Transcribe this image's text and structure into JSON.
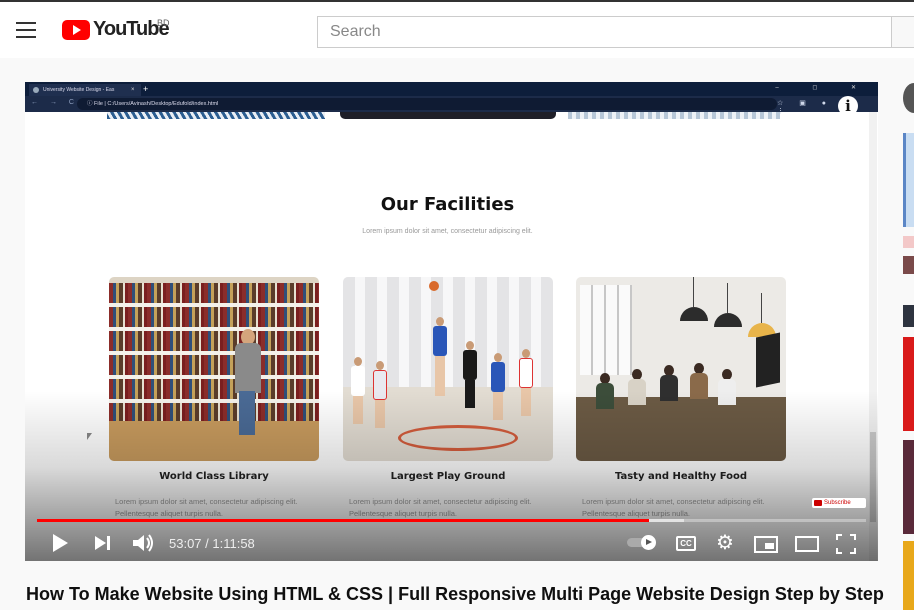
{
  "youtube": {
    "logo_text": "YouTube",
    "country_code": "BD",
    "search_placeholder": "Search"
  },
  "browser": {
    "tab_title": "University Website Design - Eas",
    "tab_close": "×",
    "new_tab": "+",
    "window_controls": "‒ ◻ ✕",
    "nav_arrows": "← → C",
    "address": "ⓘ  File  |  C:/Users/Avinash/Desktop/Edufold/index.html",
    "toolbar_icons": "☆ ▣ ● ▲ ⋮",
    "info_icon": "i"
  },
  "website": {
    "section_title": "Our Facilities",
    "section_subtitle": "Lorem ipsum dolor sit amet, consectetur adipiscing elit.",
    "cards": [
      {
        "title": "World Class Library",
        "desc": "Lorem ipsum dolor sit amet, consectetur adipiscing elit. Pellentesque aliquet turpis nulla."
      },
      {
        "title": "Largest Play Ground",
        "desc": "Lorem ipsum dolor sit amet, consectetur adipiscing elit. Pellentesque aliquet turpis nulla."
      },
      {
        "title": "Tasty and Healthy Food",
        "desc": "Lorem ipsum dolor sit amet, consectetur adipiscing elit. Pellentesque aliquet turpis nulla."
      }
    ]
  },
  "player": {
    "subscribe_label": "Subscribe",
    "time_display": "53:07 / 1:11:58",
    "progress_fraction": 0.738,
    "buffer_fraction": 0.78,
    "cc_label": "CC",
    "gear_glyph": "⚙",
    "volume_glyph": "🔊"
  },
  "video": {
    "title": "How To Make Website Using HTML & CSS | Full Responsive Multi Page Website Design Step by Step"
  },
  "colors": {
    "youtube_red": "#ff0000",
    "progress_red": "#ff0000",
    "browser_dark": "#0d1e3b"
  },
  "icons": [
    "menu-icon",
    "youtube-logo-icon",
    "search-icon",
    "info-icon",
    "play-icon",
    "next-icon",
    "volume-icon",
    "autoplay-toggle-icon",
    "cc-icon",
    "settings-gear-icon",
    "miniplayer-icon",
    "theater-icon",
    "fullscreen-icon"
  ]
}
